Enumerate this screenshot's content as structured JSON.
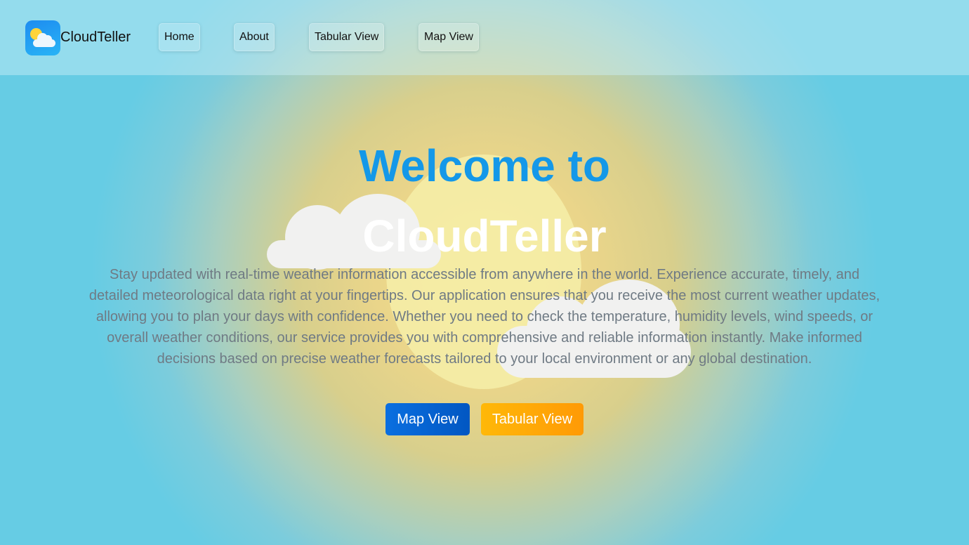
{
  "header": {
    "brand": "CloudTeller",
    "logo_icon": "partly-cloudy-icon",
    "nav": [
      {
        "label": "Home"
      },
      {
        "label": "About"
      },
      {
        "label": "Tabular View"
      },
      {
        "label": "Map View"
      }
    ]
  },
  "hero": {
    "title_line1": "Welcome to",
    "title_line2": "CloudTeller",
    "description": "Stay updated with real-time weather information accessible from anywhere in the world. Experience accurate, timely, and detailed meteorological data right at your fingertips. Our application ensures that you receive the most current weather updates, allowing you to plan your days with confidence. Whether you need to check the temperature, humidity levels, wind speeds, or overall weather conditions, our service provides you with comprehensive and reliable information instantly. Make informed decisions based on precise weather forecasts tailored to your local environment or any global destination.",
    "buttons": {
      "map": "Map View",
      "tabular": "Tabular View"
    }
  },
  "colors": {
    "title_accent": "#1498e8",
    "map_button": "#0a6fe0",
    "tabular_button": "#ffa506",
    "sky": "#66cce4",
    "sun": "#f2dd8a"
  }
}
